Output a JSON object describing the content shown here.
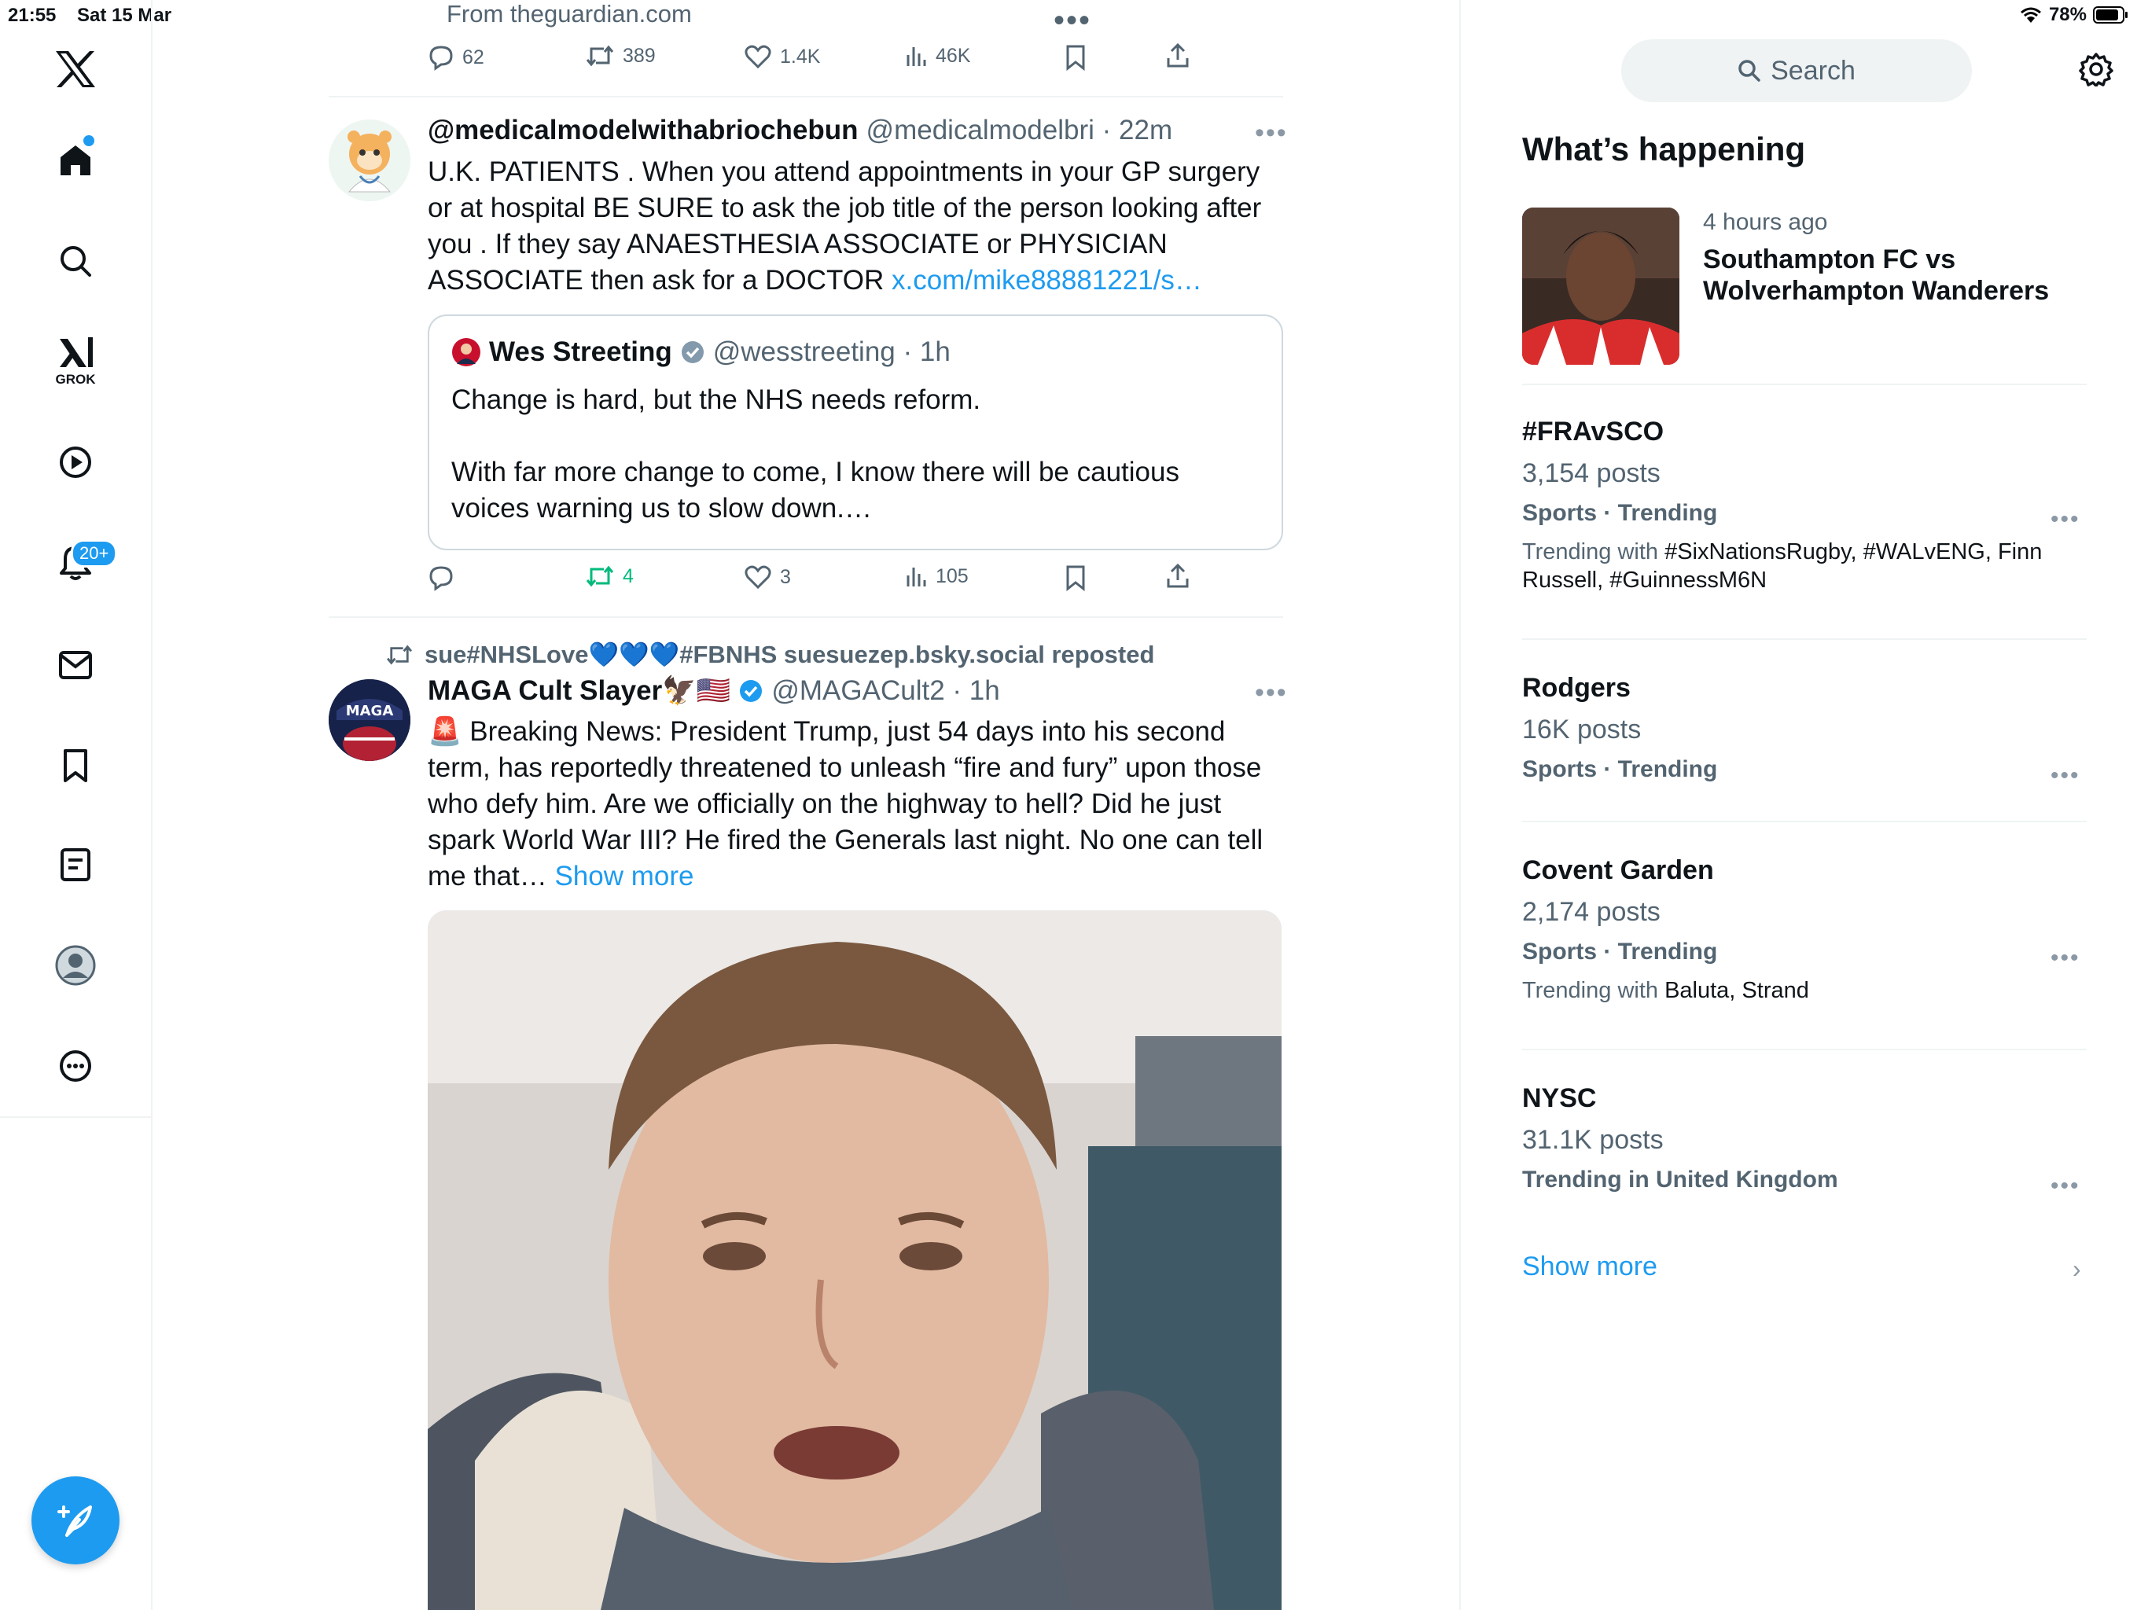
{
  "status_bar": {
    "time": "21:55",
    "date": "Sat 15 Mar",
    "battery": "78%"
  },
  "nav": {
    "items": [
      "x-logo",
      "home",
      "search",
      "grok",
      "video",
      "notifications",
      "messages",
      "bookmarks",
      "lists",
      "profile",
      "more"
    ],
    "grok_label": "GROK",
    "notifications_badge": "20+"
  },
  "feed": {
    "prev_tweet": {
      "source": "From theguardian.com",
      "replies": "62",
      "reposts": "389",
      "likes": "1.4K",
      "views": "46K"
    },
    "tweet1": {
      "name": "@medicalmodelwithabriochebun",
      "handle_time": "@medicalmodelbri · 22m",
      "text": "U.K. PATIENTS . When you attend appointments in your GP surgery or at hospital BE SURE to ask the job title of the person looking after you . If they say ANAESTHESIA ASSOCIATE or PHYSICIAN ASSOCIATE then ask for a DOCTOR ",
      "link": "x.com/mike88881221/s…",
      "quote": {
        "name": "Wes Streeting",
        "handle_time": "@wesstreeting · 1h",
        "line1": "Change is hard, but the NHS needs reform.",
        "line2": "With far more change to come, I know there will be cautious voices warning us to slow down.…"
      },
      "replies": "",
      "reposts": "4",
      "likes": "3",
      "views": "105"
    },
    "tweet2": {
      "repost_by": "sue#NHSLove💙💙💙#FBNHS suesuezep.bsky.social reposted",
      "name": "MAGA Cult Slayer🦅🇺🇸",
      "handle_time": "@MAGACult2 · 1h",
      "text": "🚨 Breaking News: President Trump, just 54 days into his second term, has reportedly threatened to unleash “fire and fury” upon those who defy him. Are we officially on the highway to hell? Did he just spark World War III? He fired the Generals last night. No one can tell me that… ",
      "show_more": "Show more",
      "avatar_text": "MAGA"
    }
  },
  "sidebar": {
    "search_placeholder": "Search",
    "section_title": "What’s happening",
    "featured": {
      "time": "4 hours ago",
      "title": "Southampton FC vs Wolverhampton Wanderers"
    },
    "trends": [
      {
        "title": "#FRAvSCO",
        "count": "3,154 posts",
        "category": "Sports · Trending",
        "with_label": "Trending with ",
        "with": "#SixNationsRugby, #WALvENG, Finn Russell, #GuinnessM6N"
      },
      {
        "title": "Rodgers",
        "count": "16K posts",
        "category": "Sports · Trending"
      },
      {
        "title": "Covent Garden",
        "count": "2,174 posts",
        "category": "Sports · Trending",
        "with_label": "Trending with ",
        "with": "Baluta, Strand"
      },
      {
        "title": "NYSC",
        "count": "31.1K posts",
        "category": "Trending in United Kingdom"
      }
    ],
    "show_more": "Show more"
  },
  "colors": {
    "accent": "#1d9bf0",
    "repost_green": "#00ba7c",
    "muted": "#536471",
    "text": "#0f1419"
  }
}
